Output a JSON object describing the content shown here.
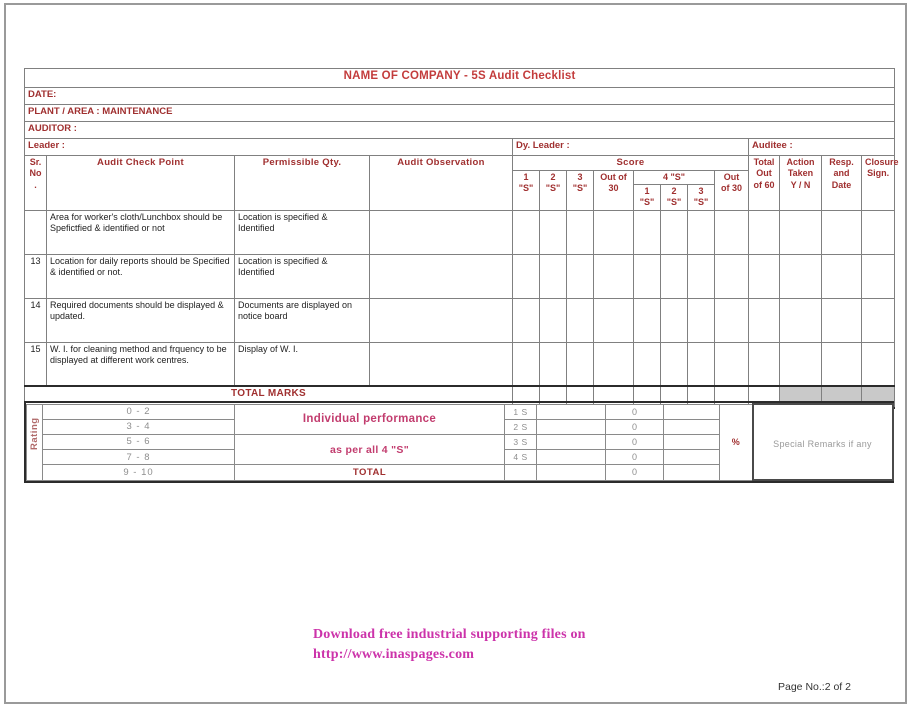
{
  "document": {
    "title": "NAME OF COMPANY - 5S Audit Checklist",
    "page_number": "Page No.:2 of 2"
  },
  "info_rows": [
    {
      "label": "DATE:"
    },
    {
      "label": "PLANT / AREA : MAINTENANCE"
    },
    {
      "label": "AUDITOR :"
    }
  ],
  "people_row": {
    "leader": "Leader :",
    "dy_leader": "Dy. Leader :",
    "auditee": "Auditee :"
  },
  "headers": {
    "sr_no": "Sr. No .",
    "sr_no_l1": "Sr.",
    "sr_no_l2": "No",
    "sr_no_l3": ".",
    "audit_check_point": "Audit Check Point",
    "permissible_qty": "Permissible Qty.",
    "audit_observation": "Audit Observation",
    "score": "Score",
    "s1_l1": "1",
    "s1_l2": "\"S\"",
    "s2_l1": "2",
    "s2_l2": "\"S\"",
    "s3_l1": "3",
    "s3_l2": "\"S\"",
    "outof30_a_l1": "Out of",
    "outof30_a_l2": "30",
    "four_s": "4 \"S\"",
    "fs1": "1 \"S\"",
    "fs2": "2 \"S\"",
    "fs3": "3 \"S\"",
    "outof30_b_l1": "Out",
    "outof30_b_l2": "of 30",
    "total_l1": "Total",
    "total_l2": "Out",
    "total_l3": "of 60",
    "action_l1": "Action",
    "action_l2": "Taken",
    "action_l3": "Y / N",
    "resp_l1": "Resp.",
    "resp_l2": "and",
    "resp_l3": "Date",
    "closure_l1": "Closure",
    "closure_l2": "Sign."
  },
  "rows": [
    {
      "sr_no": "",
      "check_point": "Area for worker's cloth/Lunchbox should be Spefictfied & identified or not",
      "permissible_qty": "Location is specified & Identified",
      "observation": ""
    },
    {
      "sr_no": "13",
      "check_point": "Location for daily reports should be Specified & identified or not.",
      "permissible_qty": "Location is specified & Identified",
      "observation": ""
    },
    {
      "sr_no": "14",
      "check_point": "Required documents should be displayed & updated.",
      "permissible_qty": "Documents are displayed on notice board",
      "observation": ""
    },
    {
      "sr_no": "15",
      "check_point": "W. I. for cleaning method and frquency to be displayed at different work centres.",
      "permissible_qty": "Display of W. I.",
      "observation": ""
    }
  ],
  "total_marks_label": "TOTAL MARKS",
  "rating": {
    "label": "Rating",
    "scale": [
      "0 - 2",
      "3 - 4",
      "5 - 6",
      "7 - 8",
      "9 - 10"
    ],
    "performance_line1": "Individual performance",
    "performance_line2": "as per all 4 \"S\"",
    "total_label": "TOTAL",
    "slabs": [
      "1 S",
      "2 S",
      "3 S",
      "4 S"
    ],
    "values": [
      "0",
      "0",
      "0",
      "0"
    ],
    "total_value": "0",
    "percent_symbol": "%",
    "remarks_label": "Special Remarks if any"
  },
  "footer": {
    "promo_line1": "Download free industrial supporting files on",
    "promo_line2": "http://www.inaspages.com"
  },
  "colors": {
    "title": "#c33c3c",
    "header_text": "#a03030",
    "promo": "#cc33aa",
    "gray_cell": "#c9c9c9"
  }
}
